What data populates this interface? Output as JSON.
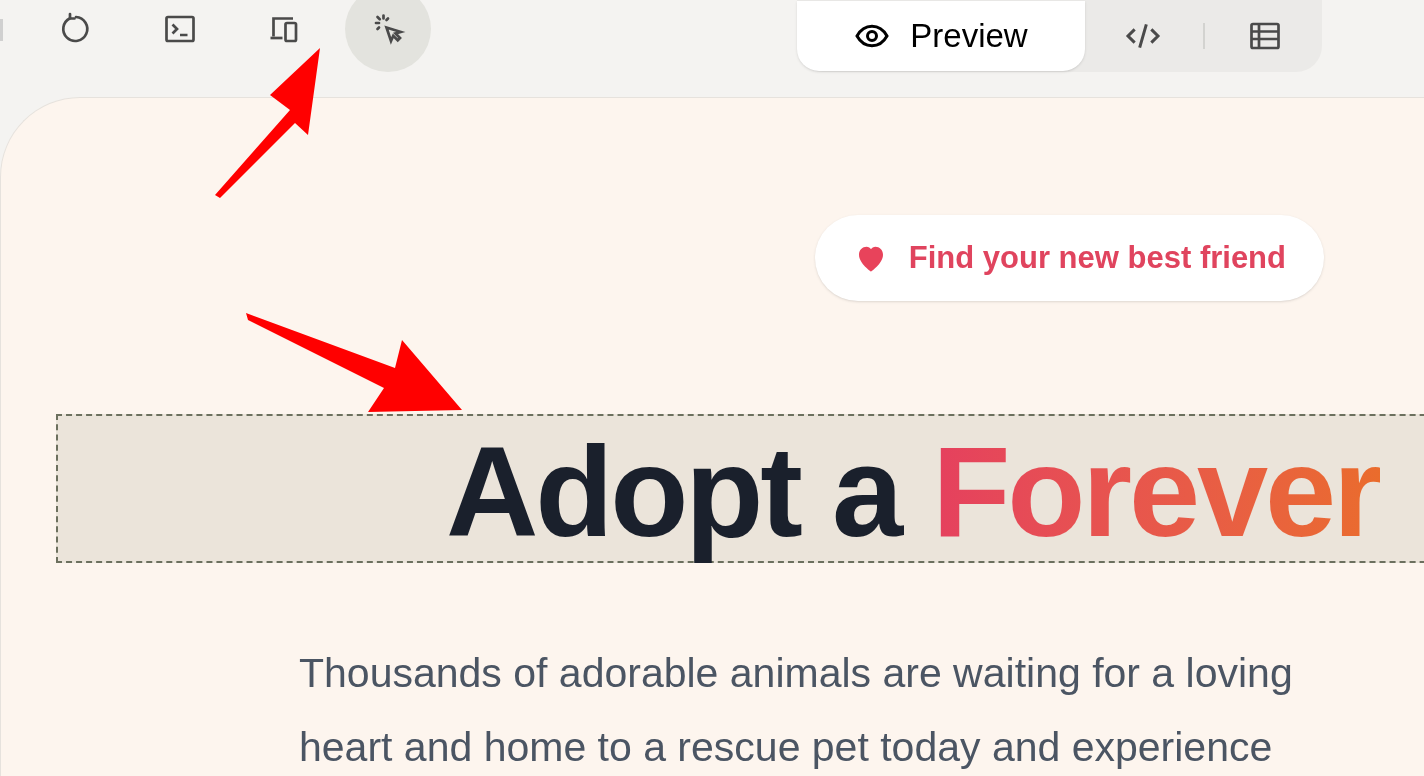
{
  "toolbar": {
    "tools": [
      {
        "kind": "refresh",
        "selected": false
      },
      {
        "kind": "terminal",
        "selected": false
      },
      {
        "kind": "devices",
        "selected": false
      },
      {
        "kind": "select",
        "selected": true
      }
    ],
    "view_tabs": [
      {
        "kind": "preview",
        "label": "Preview",
        "selected": true
      },
      {
        "kind": "code",
        "selected": false
      },
      {
        "kind": "table",
        "selected": false
      }
    ]
  },
  "preview": {
    "badge": "Find your new best friend",
    "heading": {
      "plain": "Adopt a",
      "highlight": "Forever",
      "selected": true
    },
    "paragraph_lines": [
      "Thousands of adorable animals are waiting for a loving",
      "heart and home to a rescue pet today and experience"
    ]
  }
}
